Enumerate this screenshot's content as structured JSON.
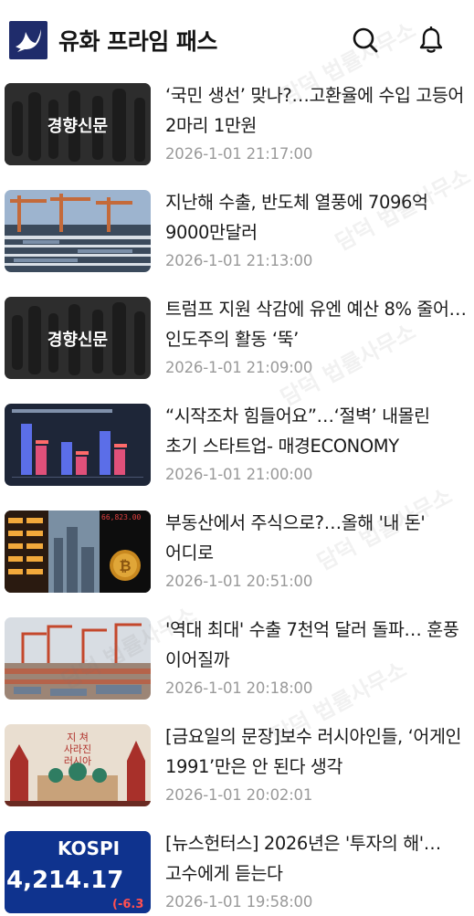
{
  "header": {
    "title": "유화 프라임 패스",
    "logo_icon": "dove-icon",
    "search_icon": "search-icon",
    "notification_icon": "bell-icon",
    "brand_color": "#1f2c6b"
  },
  "news": [
    {
      "headline": "‘국민 생선’ 맞나?…고환율에 수입 고등어 2마리 1만원",
      "time": "2026-1-01 21:17:00",
      "thumb_caption": "경향신문",
      "thumb_type": "khan"
    },
    {
      "headline": "지난해 수출, 반도체 열풍에 7096억 9000만달러",
      "time": "2026-1-01 21:13:00",
      "thumb_caption": "",
      "thumb_type": "port"
    },
    {
      "headline": "트럼프 지원 삭감에 유엔 예산 8% 줄어…인도주의 활동 ‘뚝’",
      "time": "2026-1-01 21:09:00",
      "thumb_caption": "경향신문",
      "thumb_type": "khan"
    },
    {
      "headline": "“시작조차 힘들어요”…‘절벽’ 내몰린 초기 스타트업- 매경ECONOMY",
      "time": "2026-1-01 21:00:00",
      "thumb_caption": "",
      "thumb_type": "chart"
    },
    {
      "headline": "부동산에서 주식으로?…올해 '내 돈' 어디로",
      "time": "2026-1-01 20:51:00",
      "thumb_caption": "",
      "thumb_type": "finance"
    },
    {
      "headline": "'역대 최대' 수출 7천억 달러 돌파… 훈풍 이어질까",
      "time": "2026-1-01 20:18:00",
      "thumb_caption": "",
      "thumb_type": "cranes"
    },
    {
      "headline": "[금요일의 문장]보수 러시아인들, ‘어게인 1991’만은 안 된다 생각",
      "time": "2026-1-01 20:02:01",
      "thumb_caption": "",
      "thumb_type": "book"
    },
    {
      "headline": "[뉴스헌터스] 2026년은 '투자의 해'… 고수에게 듣는다",
      "time": "2026-1-01 19:58:00",
      "thumb_caption": "",
      "thumb_type": "kospi"
    }
  ],
  "thumbs": {
    "book_title_line1": "지 쳐",
    "book_title_line2": "사라진",
    "book_title_line3": "러시아",
    "kospi_label": "KOSPI",
    "kospi_value": "4,214.17",
    "kospi_change": "(-6.3",
    "finance_ticker": "66,823.00"
  },
  "watermark_text": "담덕 법률사무소"
}
